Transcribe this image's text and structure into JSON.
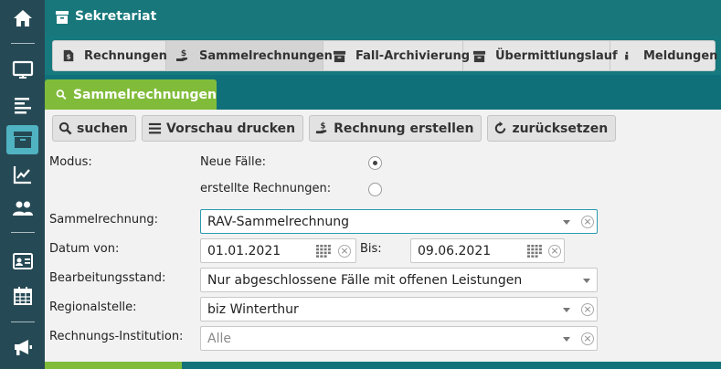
{
  "sidebar": {
    "items": [
      {
        "icon": "home-icon"
      },
      {
        "icon": "monitor-icon"
      },
      {
        "icon": "list-icon"
      },
      {
        "icon": "archive-icon",
        "active": true
      },
      {
        "icon": "chart-icon"
      },
      {
        "icon": "users-icon"
      },
      {
        "icon": "id-card-icon"
      },
      {
        "icon": "calendar-icon"
      },
      {
        "icon": "megaphone-icon"
      }
    ]
  },
  "header": {
    "title": "Sekretariat",
    "icon": "archive-icon"
  },
  "tabs": [
    {
      "label": "Rechnungen",
      "icon": "invoice-icon"
    },
    {
      "label": "Sammelrechnungen",
      "icon": "hand-money-icon",
      "active": true
    },
    {
      "label": "Fall-Archivierung",
      "icon": "archive-icon"
    },
    {
      "label": "Übermittlungslauf",
      "icon": "archive-icon"
    },
    {
      "label": "Meldungen",
      "icon": "info-icon"
    }
  ],
  "section": {
    "title": "Sammelrechnungen",
    "icon": "search-icon"
  },
  "toolbar": {
    "search": "suchen",
    "print_preview": "Vorschau drucken",
    "create_invoice": "Rechnung erstellen",
    "reset": "zurücksetzen"
  },
  "form": {
    "mode_label": "Modus:",
    "mode_options": [
      "Neue Fälle:",
      "erstellte Rechnungen:"
    ],
    "mode_selected": 0,
    "collective_label": "Sammelrechnung:",
    "collective_value": "RAV-Sammelrechnung",
    "date_from_label": "Datum von:",
    "date_from_value": "01.01.2021",
    "date_to_label": "Bis:",
    "date_to_value": "09.06.2021",
    "status_label": "Bearbeitungsstand:",
    "status_value": "Nur abgeschlossene Fälle mit offenen Leistungen",
    "region_label": "Regionalstelle:",
    "region_value": "biz Winterthur",
    "institution_label": "Rechnungs-Institution:",
    "institution_value": "Alle"
  },
  "colors": {
    "sidebar": "#264a55",
    "header": "#17777b",
    "accent_green": "#80bc3a",
    "active_sidebar": "#4fb3c2"
  }
}
